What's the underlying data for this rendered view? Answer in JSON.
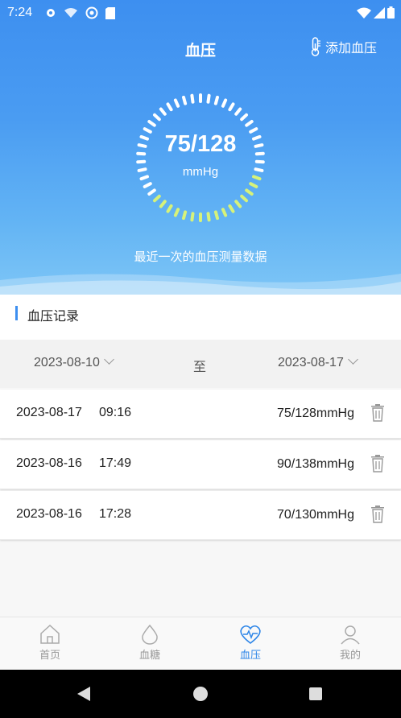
{
  "status": {
    "time": "7:24"
  },
  "header": {
    "title": "血压",
    "add_label": "添加血压"
  },
  "gauge": {
    "value": "75/128",
    "unit": "mmHg",
    "caption": "最近一次的血压测量数据"
  },
  "section": {
    "title": "血压记录"
  },
  "date_filter": {
    "start": "2023-08-10",
    "separator": "至",
    "end": "2023-08-17"
  },
  "records": [
    {
      "date": "2023-08-17",
      "time": "09:16",
      "value": "75/128mmHg"
    },
    {
      "date": "2023-08-16",
      "time": "17:49",
      "value": "90/138mmHg"
    },
    {
      "date": "2023-08-16",
      "time": "17:28",
      "value": "70/130mmHg"
    }
  ],
  "tabs": [
    {
      "label": "首页",
      "icon": "home-icon",
      "active": false
    },
    {
      "label": "血糖",
      "icon": "drop-icon",
      "active": false
    },
    {
      "label": "血压",
      "icon": "heart-pulse-icon",
      "active": true
    },
    {
      "label": "我的",
      "icon": "user-icon",
      "active": false
    }
  ],
  "colors": {
    "primary": "#3d8ff0",
    "active_tab": "#2e86e8",
    "gauge_white": "#ffffff",
    "gauge_green": "#d6f27a"
  }
}
